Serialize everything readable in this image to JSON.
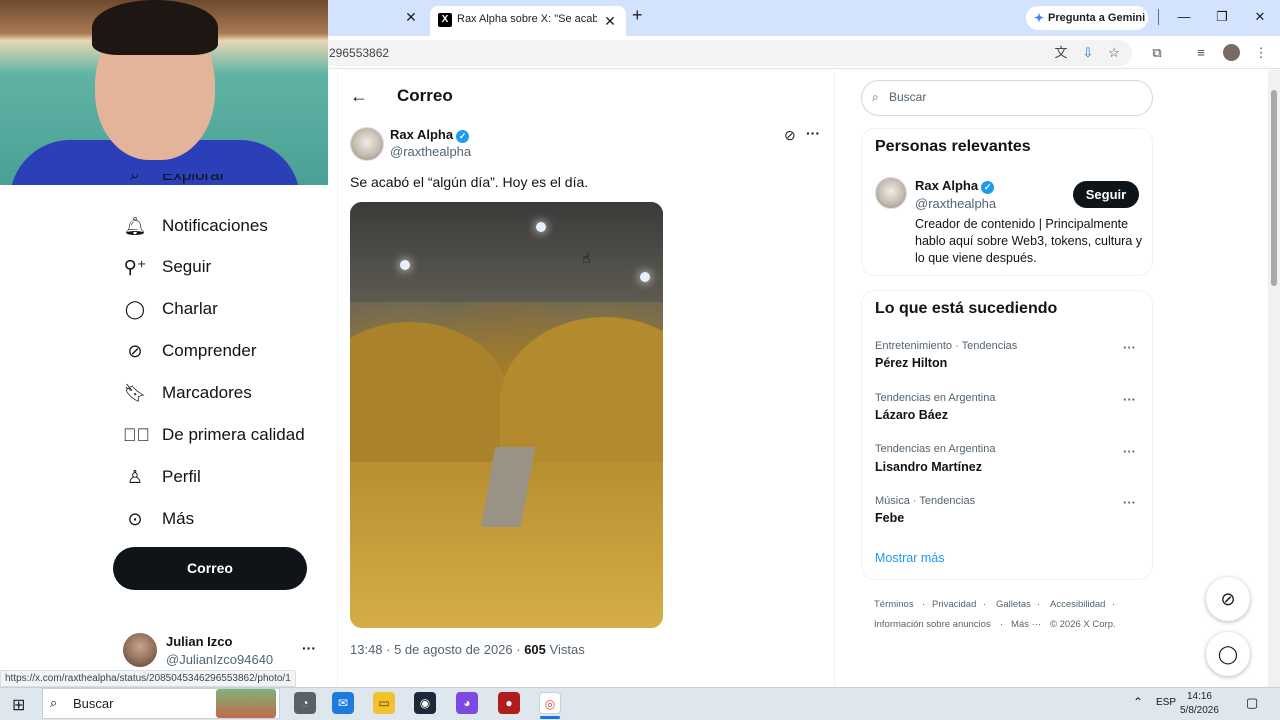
{
  "browser": {
    "prev_tab_close": "✕",
    "active_tab_title": "Rax Alpha sobre X: \"Se acabó el",
    "active_tab_close": "✕",
    "new_tab": "+",
    "gemini_label": "Pregunta a Gemini",
    "minimize": "—",
    "maximize": "❐",
    "close": "✕",
    "url": "296553862",
    "status_url": "https://x.com/raxthealpha/status/2085045346296553862/photo/1"
  },
  "sidebar": {
    "items": [
      {
        "label": "Explorar",
        "icon": "search-icon"
      },
      {
        "label": "Notificaciones",
        "icon": "bell-icon"
      },
      {
        "label": "Seguir",
        "icon": "follow-icon"
      },
      {
        "label": "Charlar",
        "icon": "chat-icon"
      },
      {
        "label": "Comprender",
        "icon": "grok-icon"
      },
      {
        "label": "Marcadores",
        "icon": "bookmark-icon"
      },
      {
        "label": "De primera calidad",
        "icon": "verified-icon"
      },
      {
        "label": "Perfil",
        "icon": "profile-icon"
      },
      {
        "label": "Más",
        "icon": "more-icon"
      }
    ],
    "post_button": "Correo",
    "account": {
      "name": "Julian Izco",
      "handle": "@JulianIzco94640",
      "more": "···"
    }
  },
  "main": {
    "title": "Correo",
    "post": {
      "author_name": "Rax Alpha",
      "author_handle": "@raxthealpha",
      "text": "Se acabó el “algún día”. Hoy es el día.",
      "time": "13:48 · 5 de agosto de 2026 ·",
      "views_count": "605",
      "views_label": "Vistas",
      "more": "···"
    }
  },
  "right": {
    "search_placeholder": "Buscar",
    "relevant": {
      "title": "Personas relevantes",
      "name": "Rax Alpha",
      "handle": "@raxthealpha",
      "follow_label": "Seguir",
      "bio": "Creador de contenido | Principalmente hablo aquí sobre Web3, tokens, cultura y lo que viene después."
    },
    "trends": {
      "title": "Lo que está sucediendo",
      "items": [
        {
          "context": "Entretenimiento · Tendencias",
          "name": "Pérez Hilton"
        },
        {
          "context": "Tendencias en Argentina",
          "name": "Lázaro Báez"
        },
        {
          "context": "Tendencias en Argentina",
          "name": "Lisandro Martínez"
        },
        {
          "context": "Música · Tendencias",
          "name": "Febe"
        }
      ],
      "more_dots": "···",
      "show_more": "Mostrar más"
    },
    "footer": {
      "terms": "Términos",
      "privacy": "Privacidad",
      "cookies": "Galletas",
      "accessibility": "Accesibilidad",
      "ads": "Información sobre anuncios",
      "more": "Más ···",
      "copyright": "© 2026 X Corp."
    }
  },
  "taskbar": {
    "search_label": "Buscar",
    "lang": "ESP",
    "time": "14:16",
    "date": "5/8/2026"
  }
}
